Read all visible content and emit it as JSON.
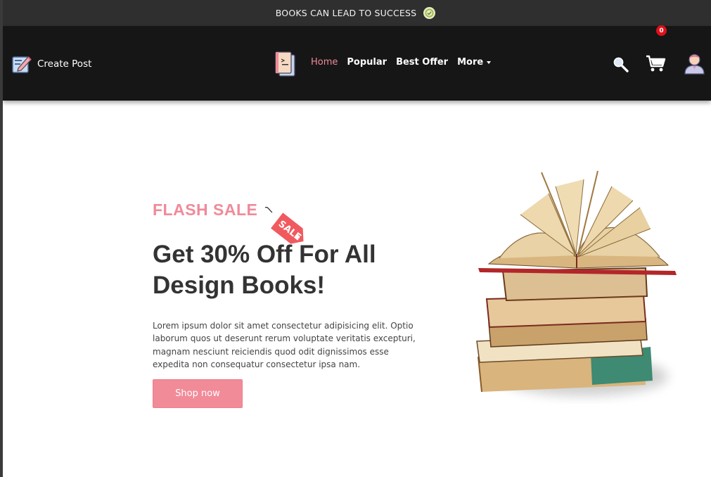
{
  "announcement": {
    "text": "BOOKS CAN LEAD TO SUCCESS",
    "icon": "check-badge-icon"
  },
  "navbar": {
    "create_post_label": "Create Post",
    "create_post_icon": "edit-document-icon",
    "logo_icon": "book-logo-icon",
    "menu": [
      {
        "label": "Home",
        "active": true
      },
      {
        "label": "Popular",
        "active": false
      },
      {
        "label": "Best Offer",
        "active": false
      },
      {
        "label": "More",
        "active": false,
        "dropdown": true
      }
    ],
    "search_icon": "search-icon",
    "cart_icon": "cart-icon",
    "cart_count": "0",
    "user_icon": "user-avatar-icon"
  },
  "hero": {
    "eyebrow": "FLASH SALE",
    "tag_text": "SALE",
    "headline_line1": "Get 30% Off For All",
    "headline_line2": "Design Books!",
    "description": "Lorem ipsum dolor sit amet consectetur adipisicing elit. Optio laborum quos ut deserunt rerum voluptate veritatis excepturi, magnam nesciunt reiciendis quod odit dignissimos esse expedita non consequatur consectetur ipsa nam.",
    "cta_label": "Shop now",
    "image": "stack-of-books-illustration"
  },
  "colors": {
    "accent": "#f08a9a",
    "button": "#f28b98",
    "navbar_bg": "#161616",
    "topbar_bg": "#2f2f2f",
    "badge": "#e0101a"
  }
}
